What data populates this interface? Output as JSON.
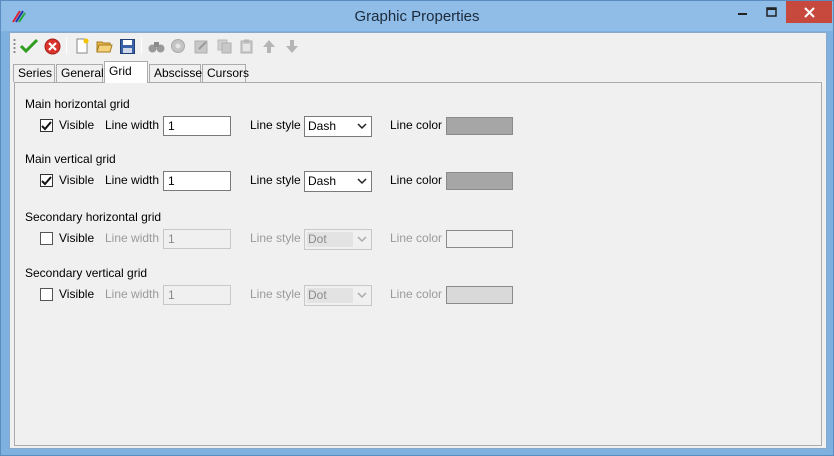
{
  "window": {
    "title": "Graphic Properties",
    "close_color": "#c7483d"
  },
  "toolbar": {
    "icons": [
      "ok-check-icon",
      "cancel-icon",
      "new-icon",
      "open-folder-icon",
      "save-disk-icon",
      "binoculars-icon",
      "filter-icon",
      "export-icon",
      "copy-icon",
      "paste-icon",
      "move-up-icon",
      "move-down-icon"
    ]
  },
  "tabs": [
    {
      "label": "Series"
    },
    {
      "label": "General"
    },
    {
      "label": "Grid"
    },
    {
      "label": "Abscisse"
    },
    {
      "label": "Cursors"
    }
  ],
  "active_tab": "Grid",
  "grid_groups": [
    {
      "title": "Main horizontal grid",
      "visible_label": "Visible",
      "visible_checked": true,
      "line_width_label": "Line width",
      "line_width": "1",
      "line_style_label": "Line style",
      "line_style": "Dash",
      "line_color_label": "Line color",
      "color": "#a6a6a6",
      "enabled": true
    },
    {
      "title": "Main vertical grid",
      "visible_label": "Visible",
      "visible_checked": true,
      "line_width_label": "Line width",
      "line_width": "1",
      "line_style_label": "Line style",
      "line_style": "Dash",
      "line_color_label": "Line color",
      "color": "#a6a6a6",
      "enabled": true
    },
    {
      "title": "Secondary horizontal grid",
      "visible_label": "Visible",
      "visible_checked": false,
      "line_width_label": "Line width",
      "line_width": "1",
      "line_style_label": "Line style",
      "line_style": "Dot",
      "line_color_label": "Line color",
      "color": "#f0f0f0",
      "enabled": false
    },
    {
      "title": "Secondary vertical grid",
      "visible_label": "Visible",
      "visible_checked": false,
      "line_width_label": "Line width",
      "line_width": "1",
      "line_style_label": "Line style",
      "line_style": "Dot",
      "line_color_label": "Line color",
      "color": "#d9d9d9",
      "enabled": false
    }
  ]
}
